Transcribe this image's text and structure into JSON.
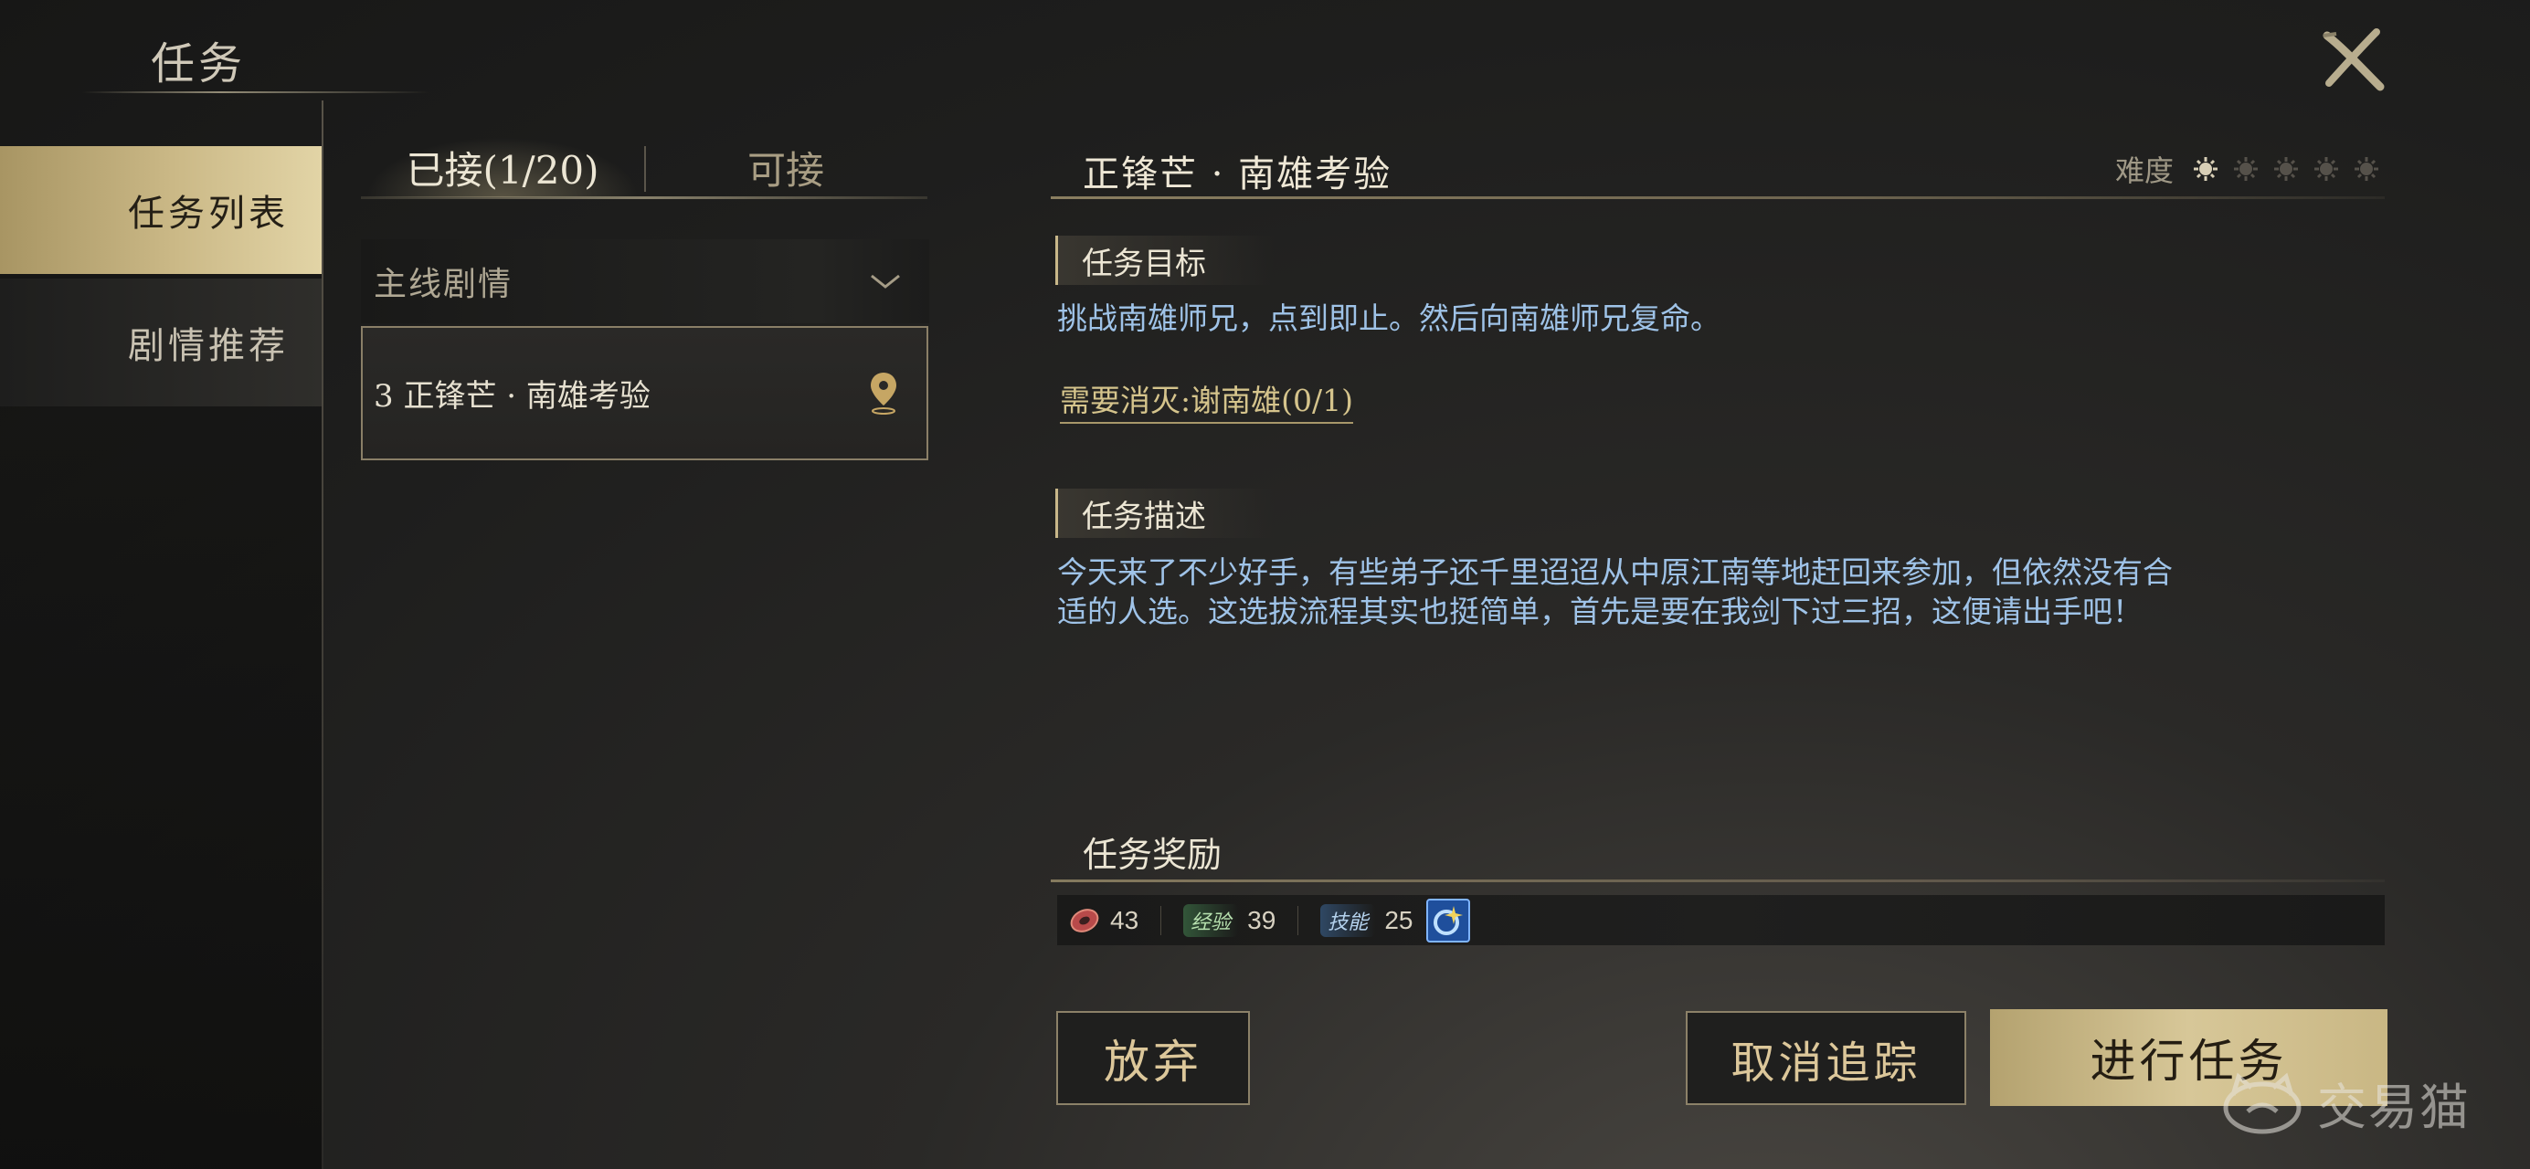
{
  "header": {
    "title": "任务"
  },
  "nav": {
    "items": [
      {
        "label": "任务列表",
        "active": true
      },
      {
        "label": "剧情推荐",
        "active": false
      }
    ]
  },
  "tabs": {
    "accepted": "已接(1/20)",
    "available": "可接"
  },
  "quest_list": {
    "category": "主线剧情",
    "items": [
      {
        "label": "3 正锋芒 · 南雄考验"
      }
    ]
  },
  "detail": {
    "title": "正锋芒 · 南雄考验",
    "difficulty_label": "难度",
    "difficulty_level": 1,
    "difficulty_max": 5,
    "objective_header": "任务目标",
    "objective_text": "挑战南雄师兄，点到即止。然后向南雄师兄复命。",
    "requirement": "需要消灭:谢南雄(0/1)",
    "description_header": "任务描述",
    "description_text": "今天来了不少好手，有些弟子还千里迢迢从中原江南等地赶回来参加，但依然没有合适的人选。这选拔流程其实也挺简单，首先是要在我剑下过三招，这便请出手吧！",
    "reward_header": "任务奖励",
    "rewards": [
      {
        "icon": "coin-icon",
        "value": "43"
      },
      {
        "label": "经验",
        "value": "39"
      },
      {
        "label": "技能",
        "value": "25"
      }
    ]
  },
  "buttons": {
    "abandon": "放弃",
    "cancel_tracking": "取消追踪",
    "proceed": "进行任务"
  },
  "watermark": {
    "text": "交易猫"
  },
  "colors": {
    "gold_accent": "#cbb987",
    "objective_text": "#9fc3e8",
    "requirement_text": "#d5c48c",
    "background": "#1e1e1d"
  }
}
